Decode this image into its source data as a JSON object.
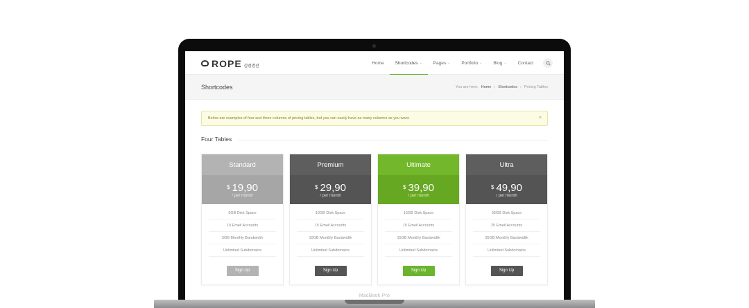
{
  "device": {
    "label": "MacBook Pro"
  },
  "header": {
    "logo_text": "ROPE",
    "logo_sub": "감성명선",
    "nav": [
      {
        "label": "Home",
        "caret": false,
        "active": false
      },
      {
        "label": "Shortcodes",
        "caret": true,
        "active": true
      },
      {
        "label": "Pages",
        "caret": true,
        "active": false
      },
      {
        "label": "Portfolio",
        "caret": true,
        "active": false
      },
      {
        "label": "Blog",
        "caret": true,
        "active": false
      },
      {
        "label": "Contact",
        "caret": false,
        "active": false
      }
    ],
    "search_icon": "search-icon",
    "accent": "#6bb42e"
  },
  "titlebar": {
    "title": "Shortcodes",
    "breadcrumb": {
      "prefix": "You are here:",
      "items": [
        "Home",
        "Shortcodes",
        "Pricing Tables"
      ],
      "separator": "›"
    }
  },
  "notice": {
    "text": "Below are examples of four and three columns of pricing tables, but you can easily have as many columns as you want.",
    "close": "×"
  },
  "section": {
    "title": "Four Tables"
  },
  "plans": [
    {
      "name": "Standard",
      "currency": "$",
      "price": "19,90",
      "period": "/ per month",
      "features": [
        "5GB Disk Space",
        "10 Email Accounts",
        "5GB Monthly Bandwidth",
        "Unlimited Subdomains"
      ],
      "button": "Sign Up",
      "colors": {
        "head": "#b3b3b3",
        "price": "#a6a6a6",
        "button": "#b3b3b3"
      }
    },
    {
      "name": "Premium",
      "currency": "$",
      "price": "29,90",
      "period": "/ per month",
      "features": [
        "10GB Disk Space",
        "15 Email Accounts",
        "10GB Monthly Bandwidth",
        "Unlimited Subdomains"
      ],
      "button": "Sign Up",
      "colors": {
        "head": "#5e5e5e",
        "price": "#545454",
        "button": "#555555"
      }
    },
    {
      "name": "Ultimate",
      "currency": "$",
      "price": "39,90",
      "period": "/ per month",
      "features": [
        "15GB Disk Space",
        "15 Email Accounts",
        "15GB Monthly Bandwidth",
        "Unlimited Subdomains"
      ],
      "button": "Sign Up",
      "colors": {
        "head": "#73b72b",
        "price": "#66a822",
        "button": "#6bb42e"
      }
    },
    {
      "name": "Ultra",
      "currency": "$",
      "price": "49,90",
      "period": "/ per month",
      "features": [
        "35GB Disk Space",
        "25 Email Accounts",
        "35GB Monthly Bandwidth",
        "Unlimited Subdomains"
      ],
      "button": "Sign Up",
      "colors": {
        "head": "#5e5e5e",
        "price": "#545454",
        "button": "#555555"
      }
    }
  ]
}
